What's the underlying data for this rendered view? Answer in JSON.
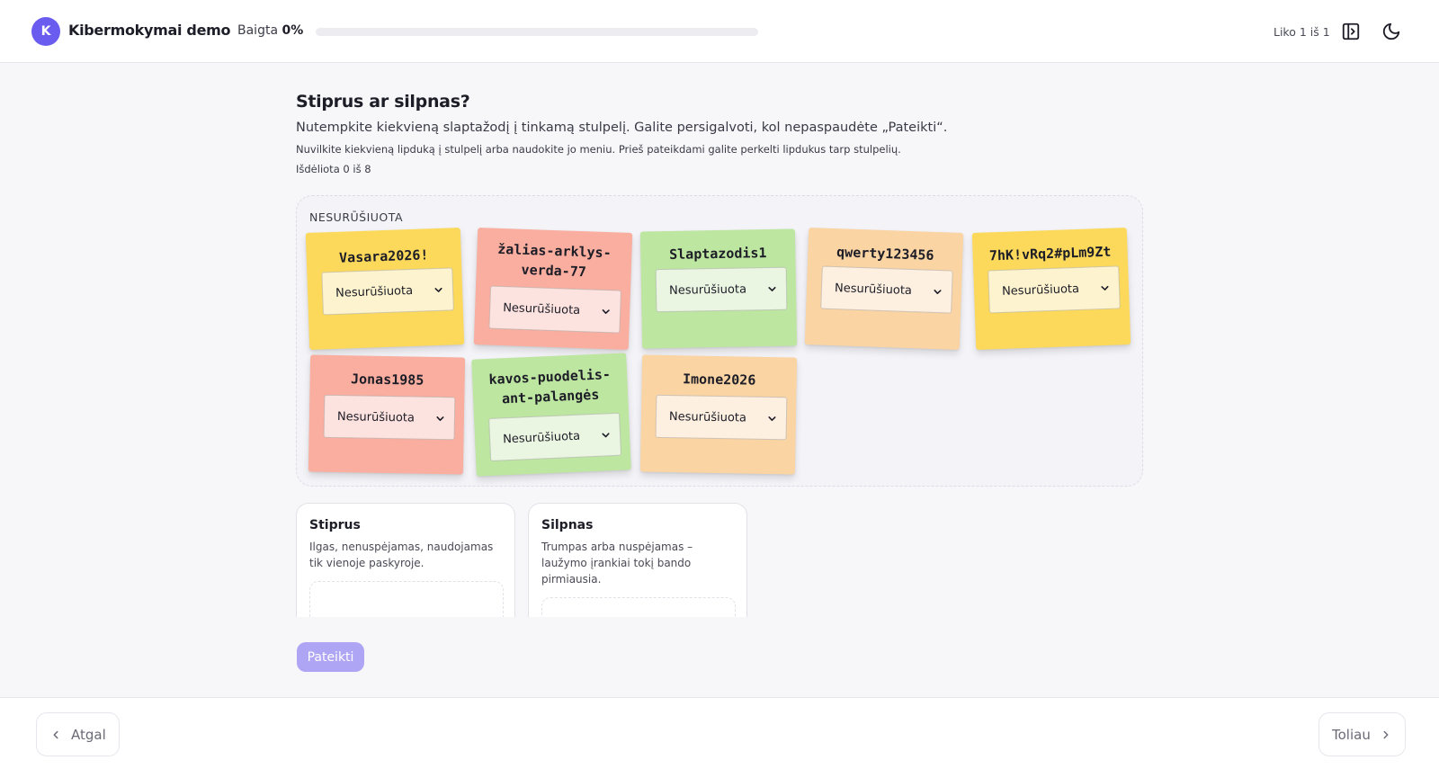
{
  "header": {
    "logo_letter": "K",
    "app_title": "Kibermokymai demo",
    "progress_label": "Baigta",
    "progress_value": "0%",
    "progress_fraction": 0,
    "remaining": "Liko 1 iš 1",
    "icons": [
      "sidebar-toggle-icon",
      "moon-icon"
    ]
  },
  "task": {
    "title": "Stiprus ar silpnas?",
    "instruction": "Nutempkite kiekvieną slaptažodį į tinkamą stulpelį. Galite persigalvoti, kol nepaspaudėte „Pateikti“.",
    "hint": "Nuvilkite kiekvieną lipduką į stulpelį arba naudokite jo meniu. Prieš pateikdami galite perkelti lipdukus tarp stulpelių.",
    "counter": "Išdėliota 0 iš 8"
  },
  "pool": {
    "label": "NESURŪŠIUOTA",
    "notes": [
      {
        "text": "Vasara2026!",
        "selected": "Nesurūšiuota",
        "color": "yellow"
      },
      {
        "text": "žalias-arklys-verda-77",
        "selected": "Nesurūšiuota",
        "color": "red"
      },
      {
        "text": "Slaptazodis1",
        "selected": "Nesurūšiuota",
        "color": "green"
      },
      {
        "text": "qwerty123456",
        "selected": "Nesurūšiuota",
        "color": "orange"
      },
      {
        "text": "7hK!vRq2#pLm9Zt",
        "selected": "Nesurūšiuota",
        "color": "yellow"
      },
      {
        "text": "Jonas1985",
        "selected": "Nesurūšiuota",
        "color": "red"
      },
      {
        "text": "kavos-puodelis-ant-palangės",
        "selected": "Nesurūšiuota",
        "color": "green"
      },
      {
        "text": "Imone2026",
        "selected": "Nesurūšiuota",
        "color": "orange"
      }
    ]
  },
  "columns": [
    {
      "title": "Stiprus",
      "description": "Ilgas, nenuspėjamas, naudojamas tik vienoje paskyroje."
    },
    {
      "title": "Silpnas",
      "description": "Trumpas arba nuspėjamas – laužymo įrankiai tokį bando pirmiausia."
    }
  ],
  "submit_label": "Pateikti",
  "footer": {
    "back_label": "Atgal",
    "next_label": "Toliau"
  },
  "colors": {
    "accent": "#6b5cf0",
    "submit_disabled": "#aea5f4",
    "note_yellow": "#fcd95b",
    "note_red": "#f9ae9f",
    "note_green": "#bde6a0",
    "note_orange": "#fbd4a3"
  }
}
